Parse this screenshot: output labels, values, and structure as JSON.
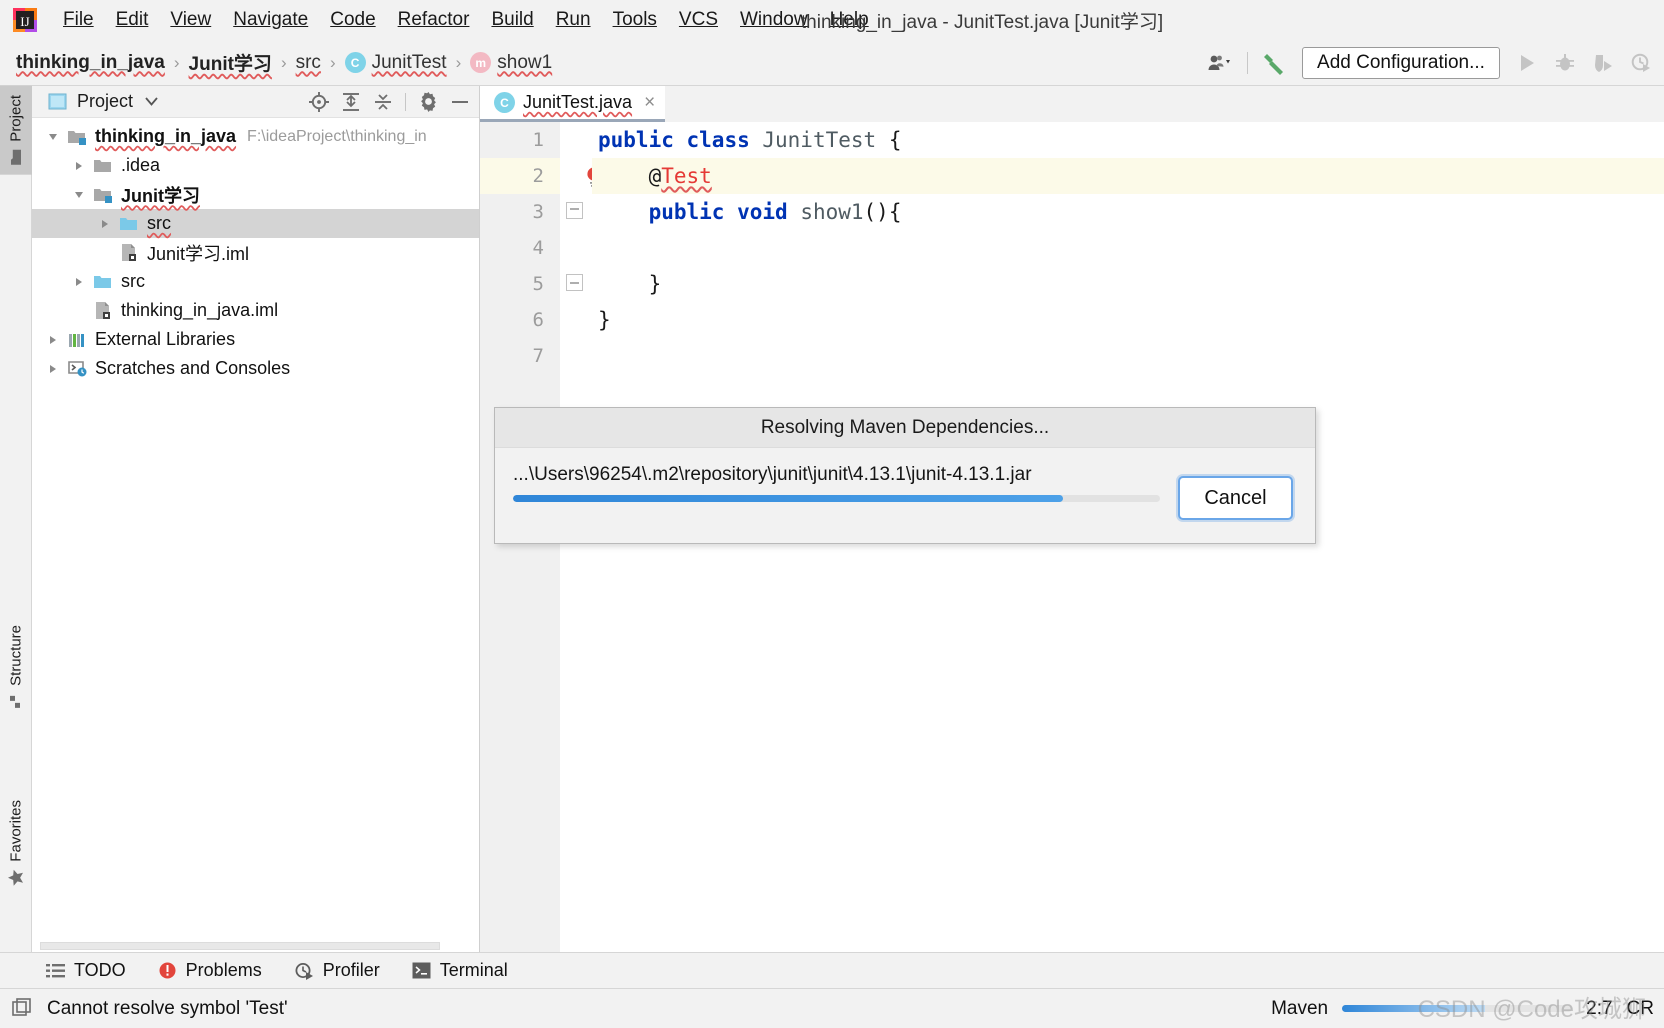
{
  "window": {
    "title": "thinking_in_java - JunitTest.java [Junit学习]"
  },
  "menubar": {
    "items": [
      {
        "label": "File",
        "mnemonic": "F"
      },
      {
        "label": "Edit",
        "mnemonic": "E"
      },
      {
        "label": "View",
        "mnemonic": "V"
      },
      {
        "label": "Navigate",
        "mnemonic": "N"
      },
      {
        "label": "Code",
        "mnemonic": "C"
      },
      {
        "label": "Refactor",
        "mnemonic": "R"
      },
      {
        "label": "Build",
        "mnemonic": "B"
      },
      {
        "label": "Run",
        "mnemonic": "u"
      },
      {
        "label": "Tools",
        "mnemonic": "T"
      },
      {
        "label": "VCS",
        "mnemonic": "S"
      },
      {
        "label": "Window",
        "mnemonic": "W"
      },
      {
        "label": "Help",
        "mnemonic": "H"
      }
    ]
  },
  "navbar": {
    "breadcrumb": [
      {
        "label": "thinking_in_java",
        "style": "bold"
      },
      {
        "label": "Junit学习",
        "style": "bold"
      },
      {
        "label": "src",
        "style": "plain"
      },
      {
        "label": "JunitTest",
        "style": "plain",
        "badge": "C"
      },
      {
        "label": "show1",
        "style": "plain",
        "badge": "m"
      }
    ],
    "separator": "›",
    "add_configuration_label": "Add Configuration...",
    "icons": [
      "user-accounts-icon",
      "chevron-down-icon",
      "build-hammer-icon",
      "run-icon",
      "debug-icon",
      "run-with-coverage-icon",
      "profile-icon"
    ]
  },
  "left_rail": {
    "buttons": [
      {
        "label": "Project",
        "icon": "project-folder-icon",
        "active": true
      },
      {
        "label": "Structure",
        "icon": "structure-icon",
        "active": false
      },
      {
        "label": "Favorites",
        "icon": "star-icon",
        "active": false
      }
    ]
  },
  "project_panel": {
    "title": "Project",
    "tool_icons": [
      "locate-icon",
      "expand-all-icon",
      "collapse-all-icon",
      "settings-gear-icon",
      "minimize-icon"
    ],
    "tree": [
      {
        "label": "thinking_in_java",
        "indent": 0,
        "toggle": "open",
        "icon": "module-folder-icon",
        "bold": true,
        "wavy": true,
        "path": "F:\\ideaProject\\thinking_in",
        "selected": false
      },
      {
        "label": ".idea",
        "indent": 1,
        "toggle": "closed",
        "icon": "folder-icon",
        "bold": false,
        "wavy": false,
        "path": "",
        "selected": false
      },
      {
        "label": "Junit学习",
        "indent": 1,
        "toggle": "open",
        "icon": "module-folder-icon",
        "bold": true,
        "wavy": true,
        "path": "",
        "selected": false
      },
      {
        "label": "src",
        "indent": 2,
        "toggle": "closed",
        "icon": "source-folder-icon",
        "bold": false,
        "wavy": true,
        "path": "",
        "selected": true
      },
      {
        "label": "Junit学习.iml",
        "indent": 2,
        "toggle": "none",
        "icon": "iml-file-icon",
        "bold": false,
        "wavy": false,
        "path": "",
        "selected": false
      },
      {
        "label": "src",
        "indent": 1,
        "toggle": "closed",
        "icon": "source-folder-icon",
        "bold": false,
        "wavy": false,
        "path": "",
        "selected": false
      },
      {
        "label": "thinking_in_java.iml",
        "indent": 1,
        "toggle": "none",
        "icon": "iml-file-icon",
        "bold": false,
        "wavy": false,
        "path": "",
        "selected": false
      },
      {
        "label": "External Libraries",
        "indent": 0,
        "toggle": "closed",
        "icon": "libraries-icon",
        "bold": false,
        "wavy": false,
        "path": "",
        "selected": false
      },
      {
        "label": "Scratches and Consoles",
        "indent": 0,
        "toggle": "closed",
        "icon": "scratches-icon",
        "bold": false,
        "wavy": false,
        "path": "",
        "selected": false
      }
    ]
  },
  "editor": {
    "tab": {
      "label": "JunitTest.java",
      "badge": "C",
      "close": "×"
    },
    "line_numbers": [
      "1",
      "2",
      "3",
      "4",
      "5",
      "6",
      "7"
    ],
    "highlighted_line": 2,
    "gutter_icon": "error-lightbulb-icon",
    "lines": [
      {
        "n": 1,
        "segments": [
          {
            "t": "public ",
            "c": "kw"
          },
          {
            "t": "class ",
            "c": "kw"
          },
          {
            "t": "JunitTest ",
            "c": "cls"
          },
          {
            "t": "{",
            "c": "pln"
          }
        ]
      },
      {
        "n": 2,
        "segments": [
          {
            "t": "    @",
            "c": "pln"
          },
          {
            "t": "Test",
            "c": "err"
          }
        ]
      },
      {
        "n": 3,
        "segments": [
          {
            "t": "    ",
            "c": "pln"
          },
          {
            "t": "public ",
            "c": "kw"
          },
          {
            "t": "void ",
            "c": "kw"
          },
          {
            "t": "show1",
            "c": "cls"
          },
          {
            "t": "(){",
            "c": "pln"
          }
        ]
      },
      {
        "n": 4,
        "segments": [
          {
            "t": "",
            "c": "pln"
          }
        ]
      },
      {
        "n": 5,
        "segments": [
          {
            "t": "    }",
            "c": "pln"
          }
        ]
      },
      {
        "n": 6,
        "segments": [
          {
            "t": "}",
            "c": "pln"
          }
        ]
      },
      {
        "n": 7,
        "segments": [
          {
            "t": "",
            "c": "pln"
          }
        ]
      }
    ]
  },
  "dialog": {
    "title": "Resolving Maven Dependencies...",
    "message": "...\\Users\\96254\\.m2\\repository\\junit\\junit\\4.13.1\\junit-4.13.1.jar",
    "progress_percent": 85,
    "cancel_label": "Cancel"
  },
  "tool_strip": {
    "buttons": [
      {
        "label": "TODO",
        "icon": "todo-list-icon"
      },
      {
        "label": "Problems",
        "icon": "problems-error-icon"
      },
      {
        "label": "Profiler",
        "icon": "profiler-icon"
      },
      {
        "label": "Terminal",
        "icon": "terminal-icon"
      }
    ]
  },
  "status_bar": {
    "message": "Cannot resolve symbol 'Test'",
    "icon": "status-notification-icon",
    "maven_label": "Maven",
    "maven_progress_percent": 62,
    "caret_position": "2:7",
    "line_separator": "CR",
    "watermark": "CSDN @Code攻城狮"
  },
  "colors": {
    "accent_blue": "#2f86d8",
    "error_red": "#e53935",
    "keyword_blue": "#0033b3",
    "selection_gray": "#d4d4d4",
    "panel_bg": "#f2f2f2",
    "highlight_line": "#fcfae8"
  }
}
